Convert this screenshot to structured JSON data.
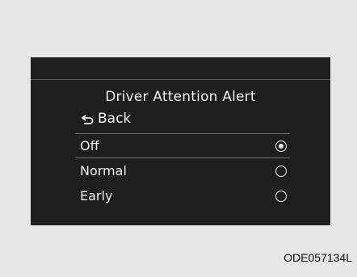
{
  "screen": {
    "title": "Driver Attention Alert",
    "back_label": "Back",
    "options": [
      {
        "label": "Off",
        "selected": true
      },
      {
        "label": "Normal",
        "selected": false
      },
      {
        "label": "Early",
        "selected": false
      }
    ]
  },
  "caption": "ODE057134L",
  "colors": {
    "page_background": "#e6e6e6",
    "screen_background": "#1e1e1e",
    "text": "#f2f2f2"
  }
}
